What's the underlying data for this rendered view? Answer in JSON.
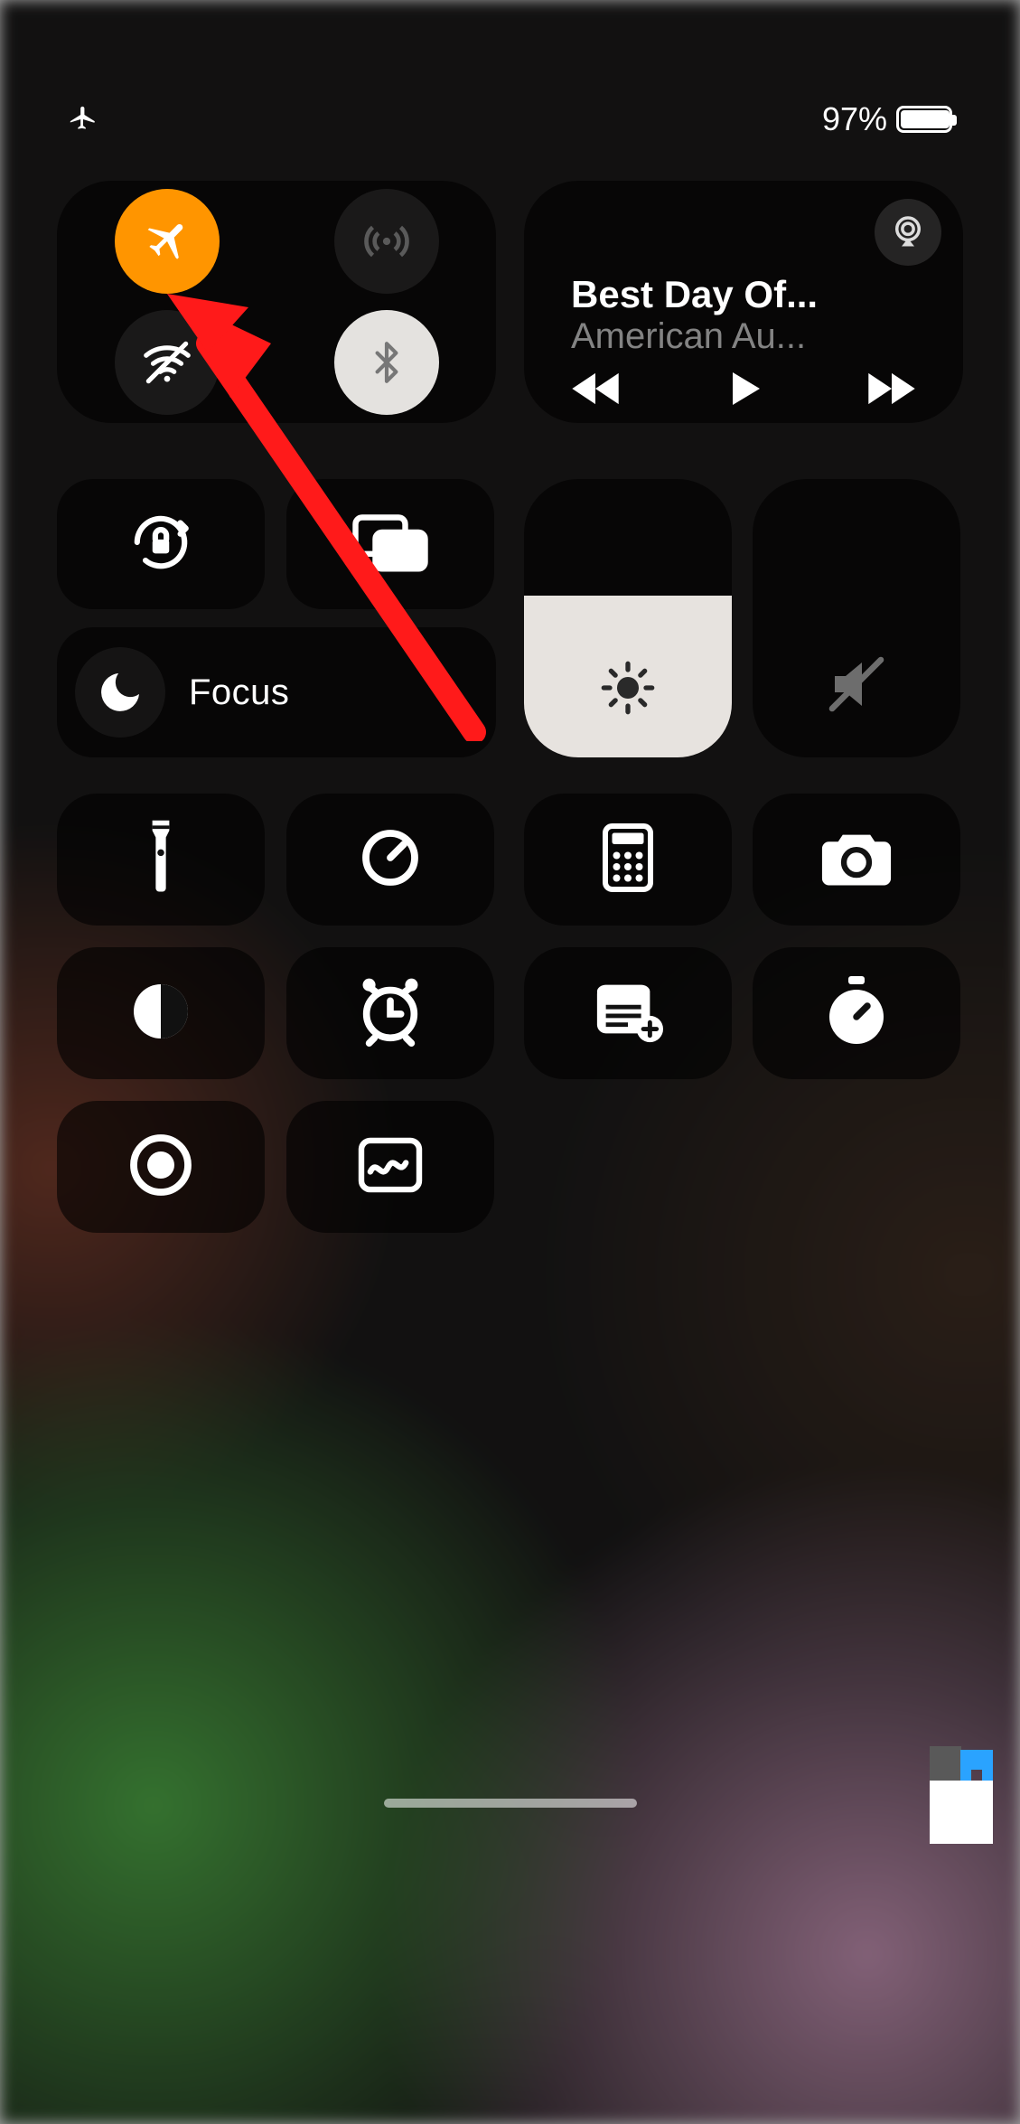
{
  "statusbar": {
    "airplane_mode_on": true,
    "battery_percent_label": "97%",
    "battery_fill_percent": 97
  },
  "connectivity": {
    "airplane": {
      "active": true
    },
    "cellular": {
      "active": false
    },
    "wifi": {
      "active": false,
      "disabled_by_airplane": true
    },
    "bluetooth": {
      "active": true
    }
  },
  "media": {
    "title": "Best Day Of...",
    "subtitle": "American Au...",
    "playing": false
  },
  "focus": {
    "label": "Focus",
    "active": false
  },
  "sliders": {
    "brightness_percent": 58,
    "volume_percent": 0,
    "volume_muted": true
  },
  "shortcuts_row1": [
    {
      "id": "flashlight",
      "name": "flashlight-icon"
    },
    {
      "id": "timer",
      "name": "timer-icon"
    },
    {
      "id": "calculator",
      "name": "calculator-icon"
    },
    {
      "id": "camera",
      "name": "camera-icon"
    }
  ],
  "shortcuts_row2": [
    {
      "id": "dark-mode",
      "name": "dark-mode-icon"
    },
    {
      "id": "alarm",
      "name": "alarm-icon"
    },
    {
      "id": "quick-note",
      "name": "quick-note-icon"
    },
    {
      "id": "stopwatch",
      "name": "stopwatch-icon"
    }
  ],
  "shortcuts_row3": [
    {
      "id": "screen-record",
      "name": "screen-record-icon"
    },
    {
      "id": "freeform",
      "name": "freeform-icon"
    }
  ],
  "colors": {
    "airplane_orange": "#ff9500",
    "annotation_red": "#ff1a1a"
  },
  "annotation": {
    "type": "arrow",
    "points_to": "airplane-mode-button"
  }
}
